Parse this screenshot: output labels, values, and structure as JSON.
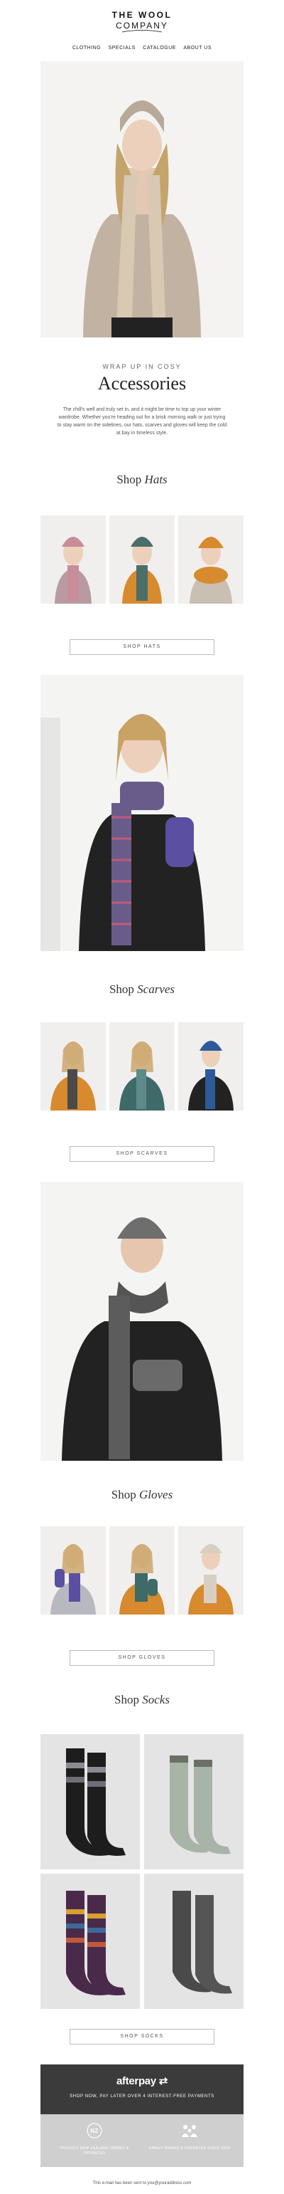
{
  "brand": {
    "line1": "THE WOOL",
    "line2": "COMPANY"
  },
  "nav": {
    "items": [
      "CLOTHING",
      "SPECIALS",
      "CATALOGUE",
      "ABOUT US"
    ]
  },
  "hero": {
    "kicker": "WRAP UP IN COSY",
    "headline": "Accessories",
    "intro": "The chill's well and truly set in, and it might be time to top up your winter wardrobe. Whether you're heading out for a brisk morning walk or just trying to stay warm on the sidelines, our hats, scarves and gloves will keep the cold at bay in timeless style."
  },
  "sections": {
    "hats": {
      "prefix": "Shop ",
      "word": "Hats",
      "button": "SHOP HATS"
    },
    "scarves": {
      "prefix": "Shop ",
      "word": "Scarves",
      "button": "SHOP SCARVES"
    },
    "gloves": {
      "prefix": "Shop ",
      "word": "Gloves",
      "button": "SHOP GLOVES"
    },
    "socks": {
      "prefix": "Shop ",
      "word": "Socks",
      "button": "SHOP SOCKS"
    }
  },
  "afterpay": {
    "logo": "afterpay",
    "tagline": "SHOP NOW, PAY LATER OVER 4 INTEREST-FREE PAYMENTS"
  },
  "badges": {
    "left": "PROUDLY NEW ZEALAND OWNED & OPERATED",
    "left_icon": "NZ",
    "right": "FAMILY OWNED & OPERATED SINCE 2004"
  },
  "footer": {
    "text": "This e-mail has been sent to you@youraddress.com"
  },
  "colors": {
    "dark_band": "#3b3b3b",
    "badge_band": "#cfcfcf",
    "text": "#333333"
  }
}
